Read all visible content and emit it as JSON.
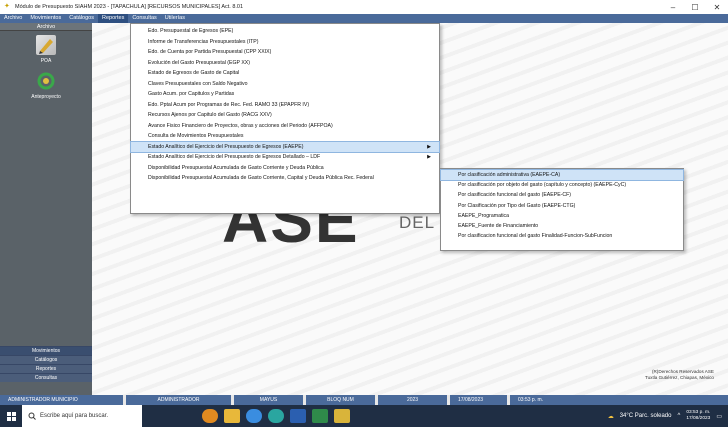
{
  "window": {
    "title": "Módulo de Presupuesto SIAHM 2023 - [TAPACHULA]   [RECURSOS MUNICIPALES]  Act. 8.01",
    "app_icon": "✦",
    "controls": [
      "–",
      "☐",
      "✕"
    ]
  },
  "menubar": [
    "Archivo",
    "Movimientos",
    "Catálogos",
    "Reportes",
    "Consultas",
    "Utilerías"
  ],
  "sidebar": {
    "header": "Archivo",
    "tools": [
      {
        "label": "POA",
        "icon": "poa-icon",
        "color": "#c9a23a"
      },
      {
        "label": "Anteproyecto",
        "icon": "anteproyecto-icon",
        "color": "#3aa84a"
      }
    ],
    "bottom": [
      "Movimientos",
      "Catálogos",
      "Reportes",
      "Consultas"
    ]
  },
  "menu1": {
    "items": [
      "Edo. Presupuestal de Egresos (EPE)",
      "Informe de Transferencias Presupuestales (ITP)",
      "Edo. de Cuenta por Partida Presupuestal (CPP XXIX)",
      "Evolución del Gasto Presupuestal (EGP XX)",
      "Estado de Egresos de Gasto de Capital",
      "Claves Presupuestales con Saldo Negativo",
      "Gasto Acum. por Capitulos y Partidas",
      "Edo. Pptal Acum por Programas de Rec. Fed. RAMO 33 (EPAPFR IV)",
      "Recursos Ajenos por Capitulo del Gasto (RACG XXV)",
      "Avance Fisico Financiero de Proyectos, obras y acciones del Periodo (AFFPOA)",
      "Consulta de Movimientos Presupuestales",
      "Estado Analítico del Ejercicio del Presupuesto de Egresos (EAEPE)",
      "Estado Analítico del Ejercicio del Presupuesto de Egresos Detallado – LDF",
      "Disponibilidad Presupuestal Acumulada de Gasto Corriente y Deuda Pública",
      "Disponibilidad Presupuestal Acumulada de Gasto Corriente, Capital y Deuda Pública Rec. Federal"
    ],
    "selected_index": 11,
    "submenu_indices": [
      11,
      12
    ]
  },
  "menu2": {
    "items": [
      "Por clasificación administrativa (EAEPE-CA)",
      "Por clasificación por objeto del gasto (capítulo y concepto) (EAEPE-CyC)",
      "Por clasificación funcional del gasto (EAEPE-CF)",
      "Por Clasificación por Tipo del Gasto (EAEPE-CTG)",
      "EAEPE_Programatica",
      "EAEPE_Fuente de Financiamiento",
      "Por clasificacion funcional del gasto Finalidad-Funcion-SubFuncion"
    ],
    "selected_index": 0
  },
  "background": {
    "logo": "ASE",
    "logo_sub": "DEL E",
    "copyright_line1": "(R)Derechos Reservados ASE",
    "copyright_line2": "Tuxtla Gutiérrez, Chiapas, México"
  },
  "statusbar": [
    "ADMINISTRADOR MUNICIPIO",
    "ADMINISTRADOR",
    "MAYUS",
    "BLOQ NUM",
    "2023",
    "17/08/2023",
    "03:53 p. m."
  ],
  "taskbar": {
    "search_placeholder": "Escribe aquí para buscar.",
    "weather": "34°C  Parc. soleado",
    "time": "03:53 p. m.",
    "date": "17/08/2023",
    "apps": [
      {
        "name": "task-view-icon",
        "color": "#e08a20"
      },
      {
        "name": "file-explorer-icon",
        "color": "#e8b83a"
      },
      {
        "name": "chrome-icon",
        "color": "#3a8de0"
      },
      {
        "name": "edge-icon",
        "color": "#2aa6a0"
      },
      {
        "name": "word-icon",
        "color": "#2b5fb0"
      },
      {
        "name": "excel-icon",
        "color": "#2f8a4a"
      },
      {
        "name": "siahm-app-icon",
        "color": "#d9b43a"
      }
    ]
  }
}
